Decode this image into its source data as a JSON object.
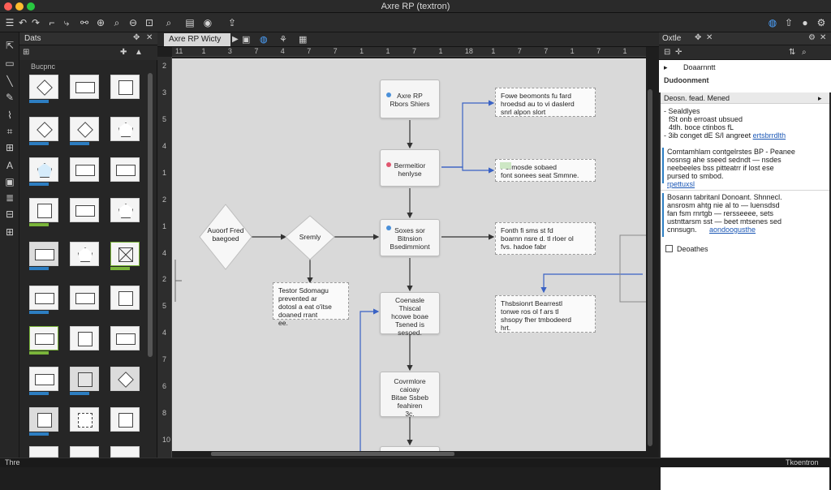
{
  "window": {
    "title": "Axre RP (textron)",
    "traffic": {
      "close": "#ff5f57",
      "min": "#febc2e",
      "max": "#28c840"
    }
  },
  "widgets_panel": {
    "tab_label": "Dats",
    "library_label": "Bucpnc",
    "accent": "#2d7ec2",
    "accent_alt": "#7ab53a"
  },
  "document": {
    "tab_label": "Axre RP Wicty"
  },
  "ruler": {
    "horizontal_ticks": [
      "11",
      "1",
      "3",
      "7",
      "4",
      "7",
      "7",
      "1",
      "1",
      "7",
      "1",
      "18",
      "1",
      "7",
      "7",
      "1",
      "7",
      "1"
    ],
    "vertical_ticks": [
      "2",
      "3",
      "5",
      "4",
      "1",
      "2",
      "1",
      "4",
      "2",
      "5",
      "4",
      "7",
      "6",
      "8",
      "10"
    ]
  },
  "flow": {
    "n1": "Axre RP\nRbors Shiers",
    "n2": "Bermeitior\nhenlyse",
    "n3": "Soxes sor\nBitnsion\nBsedimmiont",
    "n4": "Coenasle\nThiscal\nhcowe boae\nTsened is\nsesoed.",
    "n5": "Covrmlore\ncaioay\nBitae Ssbeb\nfeahiren\n3c.",
    "start_label": "Auoorf Fred\nbaegoed",
    "decision_label": "Sremly",
    "note_1": "Fowe beomonts fu fard\nhroedsd au to vi daslerd\nsnrl alpon slort",
    "note_2": "Pormosde sobaed\nfont sonees seat Smmne.",
    "note_3": "Fonth fi sms st fd\nboarnn nsre d. tl rloer ol\nfvs. hadoe fabr",
    "note_4": "Thsbsionrt Bearrestl\ntonwe ros ol f ars tl\nshsopy fher tmbodeerd\nhrt.",
    "note_5": "Testor Sdomagu\nprevented ar\ndotosl a eat o'itse\ndoaned rrant\nee."
  },
  "outline_panel": {
    "tab_label": "Oxtle",
    "doc_header": "Doaarnntt",
    "doc_subheader": "Dudoonment",
    "props_label": "Deosn. fead. Mened",
    "list": [
      "Sealdlyes",
      "fSt onb erroast ubsued",
      "4tlh. boce ctinbos fL",
      "3ib conget dE S/I angreet"
    ],
    "list_link": "ertsbrrdlth",
    "block_1": [
      "Comtamhlam contgelrstes BP - Peanee",
      "nosnsg ahe sseed sedndt — nsdes",
      "neebeeles bss pitteatrr if lost ese",
      "pursed to smbod."
    ],
    "block_1_link": "rpettuxsl",
    "block_2": [
      "Bosann tabritanl Donoant. Shnnecl.",
      "ansrosm ahtg nie al to — luensdsd",
      "fan fsm rnrtgb — rersseeee, sets",
      "ustnttarsm sst — beet mtsenes sed",
      "cnnsugn."
    ],
    "block_2_link": "aondoogusthe",
    "checkbox_label": "Deoathes"
  },
  "status": {
    "left": "Thre",
    "right": "Tkoentron"
  }
}
